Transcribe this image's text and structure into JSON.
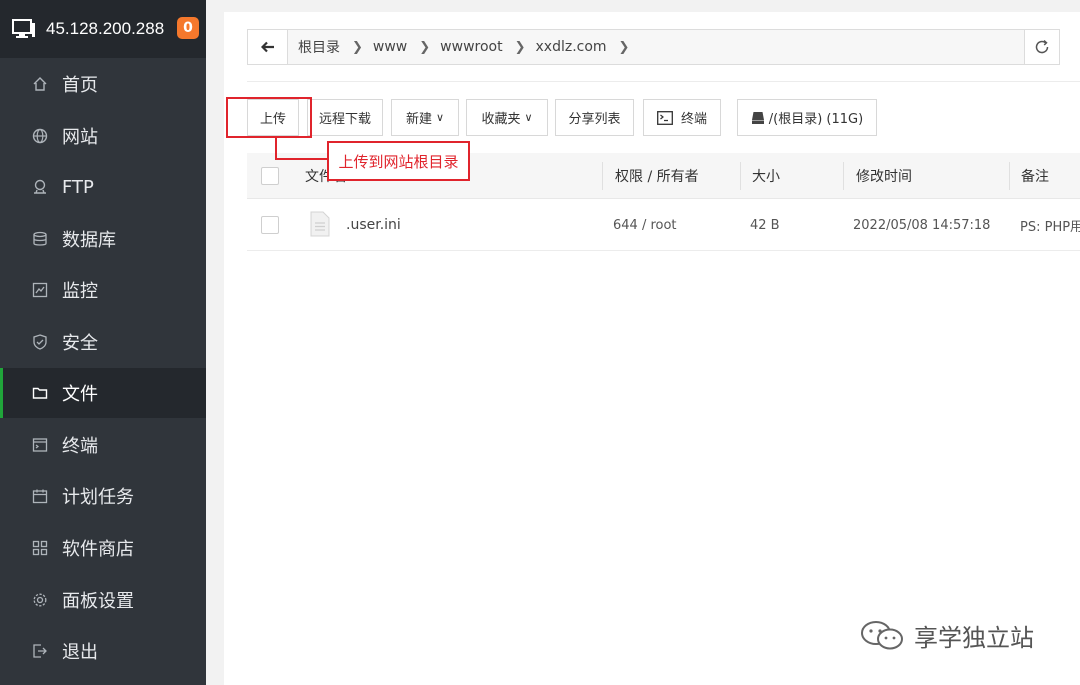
{
  "header": {
    "ip": "45.128.200.288",
    "badge": "0"
  },
  "sidebar": {
    "items": [
      {
        "label": "首页",
        "icon": "home-icon"
      },
      {
        "label": "网站",
        "icon": "globe-icon"
      },
      {
        "label": "FTP",
        "icon": "ftp-icon"
      },
      {
        "label": "数据库",
        "icon": "database-icon"
      },
      {
        "label": "监控",
        "icon": "monitor-icon"
      },
      {
        "label": "安全",
        "icon": "shield-icon"
      },
      {
        "label": "文件",
        "icon": "folder-icon",
        "active": true
      },
      {
        "label": "终端",
        "icon": "terminal-icon"
      },
      {
        "label": "计划任务",
        "icon": "calendar-icon"
      },
      {
        "label": "软件商店",
        "icon": "apps-icon"
      },
      {
        "label": "面板设置",
        "icon": "gear-icon"
      },
      {
        "label": "退出",
        "icon": "logout-icon"
      }
    ],
    "accent": "#20a53a"
  },
  "breadcrumb": {
    "segments": [
      "根目录",
      "www",
      "wwwroot",
      "xxdlz.com"
    ]
  },
  "toolbar": {
    "upload": "上传",
    "remote_download": "远程下载",
    "new": "新建",
    "favorites": "收藏夹",
    "share_list": "分享列表",
    "terminal": "终端",
    "disk": "/(根目录) (11G)"
  },
  "annotation": {
    "callout": "上传到网站根目录",
    "color": "#e0242c"
  },
  "table": {
    "headers": {
      "name": "文件名",
      "perm": "权限 / 所有者",
      "size": "大小",
      "mtime": "修改时间",
      "note": "备注"
    },
    "rows": [
      {
        "name": ".user.ini",
        "perm": "644 / root",
        "size": "42 B",
        "mtime": "2022/05/08 14:57:18",
        "note": "PS: PHP用"
      }
    ]
  },
  "watermark": {
    "text": "享学独立站"
  }
}
